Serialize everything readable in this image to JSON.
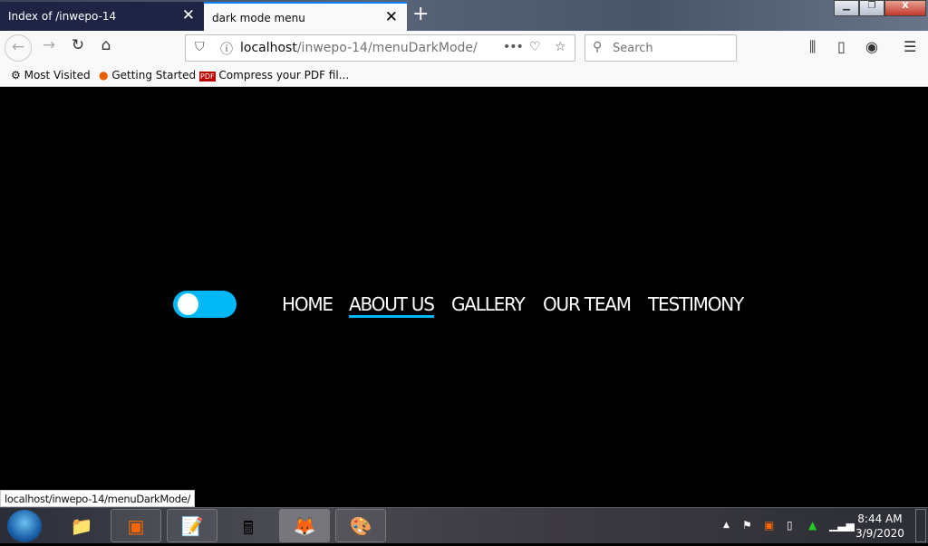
{
  "browser": {
    "tabs": [
      {
        "label": "Index of /inwepo-14",
        "active": false
      },
      {
        "label": "dark mode menu",
        "active": true
      }
    ],
    "url_host": "localhost",
    "url_path": "/inwepo-14/menuDarkMode/",
    "search_placeholder": "Search",
    "bookmarks": [
      "Most Visited",
      "Getting Started",
      "Compress your PDF fil..."
    ],
    "status_url": "localhost/inwepo-14/menuDarkMode/"
  },
  "page": {
    "toggle_on": true,
    "accent": "#00b8f5",
    "menu": [
      {
        "label": "HOME"
      },
      {
        "label": "ABOUT US",
        "active": true
      },
      {
        "label": "GALLERY"
      },
      {
        "label": "OUR TEAM"
      },
      {
        "label": "TESTIMONY"
      }
    ]
  },
  "taskbar": {
    "time": "8:44 AM",
    "date": "3/9/2020"
  }
}
